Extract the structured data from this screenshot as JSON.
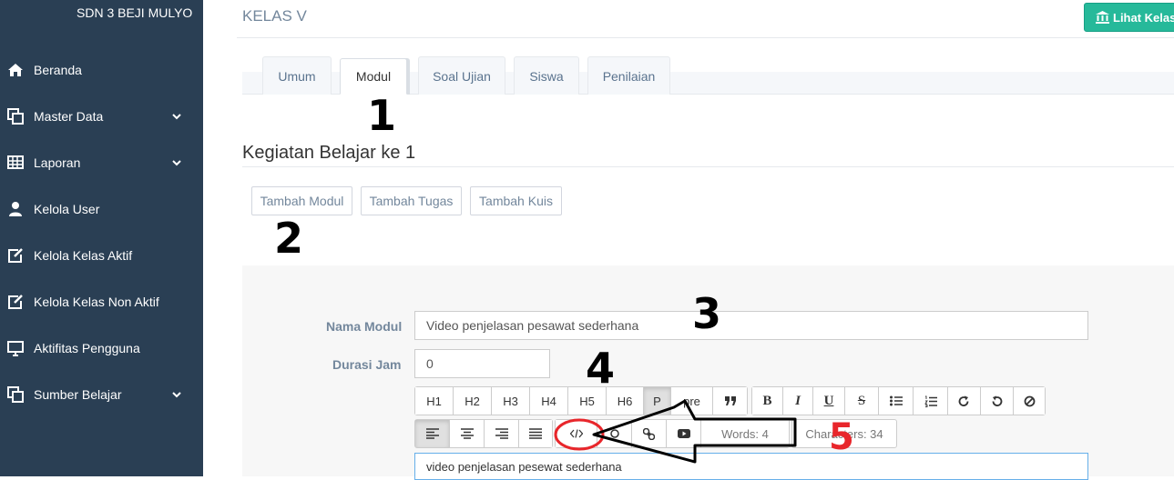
{
  "sidebar": {
    "brand": "SDN 3 BEJI MULYO",
    "items": [
      {
        "label": "Beranda",
        "icon": "home-icon"
      },
      {
        "label": "Master Data",
        "icon": "clone-icon"
      },
      {
        "label": "Laporan",
        "icon": "table-icon"
      },
      {
        "label": "Kelola User",
        "icon": "user-icon"
      },
      {
        "label": "Kelola Kelas Aktif",
        "icon": "edit-icon"
      },
      {
        "label": "Kelola Kelas Non Aktif",
        "icon": "edit-icon"
      },
      {
        "label": "Aktifitas Pengguna",
        "icon": "desktop-icon"
      },
      {
        "label": "Sumber Belajar",
        "icon": "clone-icon"
      }
    ]
  },
  "header": {
    "title": "KELAS V",
    "lihat_kelas": "Lihat Kelas"
  },
  "tabs": [
    "Umum",
    "Modul",
    "Soal Ujian",
    "Siswa",
    "Penilaian"
  ],
  "section_title": "Kegiatan Belajar ke 1",
  "actions": [
    "Tambah Modul",
    "Tambah Tugas",
    "Tambah Kuis"
  ],
  "form": {
    "nama_modul_label": "Nama Modul",
    "nama_modul_value": "Video penjelasan pesawat sederhana",
    "durasi_label": "Durasi Jam",
    "durasi_value": "0"
  },
  "toolbar": {
    "headings": [
      "H1",
      "H2",
      "H3",
      "H4",
      "H5",
      "H6",
      "P",
      "pre"
    ],
    "words": "Words: 4",
    "characters": "Characters: 34"
  },
  "editor_text": "video penjelasan pesewat sederhana",
  "annotations": {
    "n1": "1",
    "n2": "2",
    "n3": "3",
    "n4": "4",
    "n5": "5"
  },
  "colors": {
    "sidebar": "#2a3f54",
    "accent": "#26b99a",
    "annotation_red": "#e8262b"
  }
}
